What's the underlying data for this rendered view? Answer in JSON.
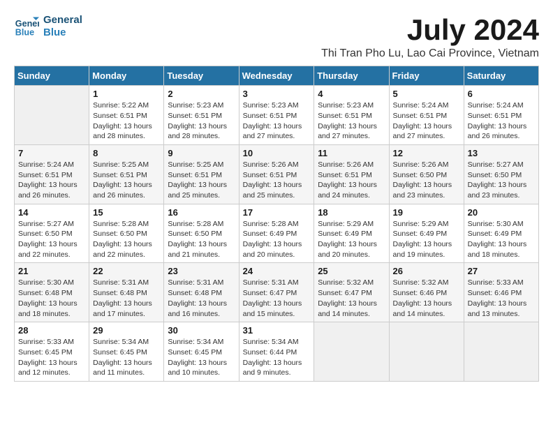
{
  "logo": {
    "line1": "General",
    "line2": "Blue"
  },
  "title": "July 2024",
  "subtitle": "Thi Tran Pho Lu, Lao Cai Province, Vietnam",
  "weekdays": [
    "Sunday",
    "Monday",
    "Tuesday",
    "Wednesday",
    "Thursday",
    "Friday",
    "Saturday"
  ],
  "weeks": [
    [
      {
        "day": "",
        "info": ""
      },
      {
        "day": "1",
        "info": "Sunrise: 5:22 AM\nSunset: 6:51 PM\nDaylight: 13 hours\nand 28 minutes."
      },
      {
        "day": "2",
        "info": "Sunrise: 5:23 AM\nSunset: 6:51 PM\nDaylight: 13 hours\nand 28 minutes."
      },
      {
        "day": "3",
        "info": "Sunrise: 5:23 AM\nSunset: 6:51 PM\nDaylight: 13 hours\nand 27 minutes."
      },
      {
        "day": "4",
        "info": "Sunrise: 5:23 AM\nSunset: 6:51 PM\nDaylight: 13 hours\nand 27 minutes."
      },
      {
        "day": "5",
        "info": "Sunrise: 5:24 AM\nSunset: 6:51 PM\nDaylight: 13 hours\nand 27 minutes."
      },
      {
        "day": "6",
        "info": "Sunrise: 5:24 AM\nSunset: 6:51 PM\nDaylight: 13 hours\nand 26 minutes."
      }
    ],
    [
      {
        "day": "7",
        "info": "Sunrise: 5:24 AM\nSunset: 6:51 PM\nDaylight: 13 hours\nand 26 minutes."
      },
      {
        "day": "8",
        "info": "Sunrise: 5:25 AM\nSunset: 6:51 PM\nDaylight: 13 hours\nand 26 minutes."
      },
      {
        "day": "9",
        "info": "Sunrise: 5:25 AM\nSunset: 6:51 PM\nDaylight: 13 hours\nand 25 minutes."
      },
      {
        "day": "10",
        "info": "Sunrise: 5:26 AM\nSunset: 6:51 PM\nDaylight: 13 hours\nand 25 minutes."
      },
      {
        "day": "11",
        "info": "Sunrise: 5:26 AM\nSunset: 6:51 PM\nDaylight: 13 hours\nand 24 minutes."
      },
      {
        "day": "12",
        "info": "Sunrise: 5:26 AM\nSunset: 6:50 PM\nDaylight: 13 hours\nand 23 minutes."
      },
      {
        "day": "13",
        "info": "Sunrise: 5:27 AM\nSunset: 6:50 PM\nDaylight: 13 hours\nand 23 minutes."
      }
    ],
    [
      {
        "day": "14",
        "info": "Sunrise: 5:27 AM\nSunset: 6:50 PM\nDaylight: 13 hours\nand 22 minutes."
      },
      {
        "day": "15",
        "info": "Sunrise: 5:28 AM\nSunset: 6:50 PM\nDaylight: 13 hours\nand 22 minutes."
      },
      {
        "day": "16",
        "info": "Sunrise: 5:28 AM\nSunset: 6:50 PM\nDaylight: 13 hours\nand 21 minutes."
      },
      {
        "day": "17",
        "info": "Sunrise: 5:28 AM\nSunset: 6:49 PM\nDaylight: 13 hours\nand 20 minutes."
      },
      {
        "day": "18",
        "info": "Sunrise: 5:29 AM\nSunset: 6:49 PM\nDaylight: 13 hours\nand 20 minutes."
      },
      {
        "day": "19",
        "info": "Sunrise: 5:29 AM\nSunset: 6:49 PM\nDaylight: 13 hours\nand 19 minutes."
      },
      {
        "day": "20",
        "info": "Sunrise: 5:30 AM\nSunset: 6:49 PM\nDaylight: 13 hours\nand 18 minutes."
      }
    ],
    [
      {
        "day": "21",
        "info": "Sunrise: 5:30 AM\nSunset: 6:48 PM\nDaylight: 13 hours\nand 18 minutes."
      },
      {
        "day": "22",
        "info": "Sunrise: 5:31 AM\nSunset: 6:48 PM\nDaylight: 13 hours\nand 17 minutes."
      },
      {
        "day": "23",
        "info": "Sunrise: 5:31 AM\nSunset: 6:48 PM\nDaylight: 13 hours\nand 16 minutes."
      },
      {
        "day": "24",
        "info": "Sunrise: 5:31 AM\nSunset: 6:47 PM\nDaylight: 13 hours\nand 15 minutes."
      },
      {
        "day": "25",
        "info": "Sunrise: 5:32 AM\nSunset: 6:47 PM\nDaylight: 13 hours\nand 14 minutes."
      },
      {
        "day": "26",
        "info": "Sunrise: 5:32 AM\nSunset: 6:46 PM\nDaylight: 13 hours\nand 14 minutes."
      },
      {
        "day": "27",
        "info": "Sunrise: 5:33 AM\nSunset: 6:46 PM\nDaylight: 13 hours\nand 13 minutes."
      }
    ],
    [
      {
        "day": "28",
        "info": "Sunrise: 5:33 AM\nSunset: 6:45 PM\nDaylight: 13 hours\nand 12 minutes."
      },
      {
        "day": "29",
        "info": "Sunrise: 5:34 AM\nSunset: 6:45 PM\nDaylight: 13 hours\nand 11 minutes."
      },
      {
        "day": "30",
        "info": "Sunrise: 5:34 AM\nSunset: 6:45 PM\nDaylight: 13 hours\nand 10 minutes."
      },
      {
        "day": "31",
        "info": "Sunrise: 5:34 AM\nSunset: 6:44 PM\nDaylight: 13 hours\nand 9 minutes."
      },
      {
        "day": "",
        "info": ""
      },
      {
        "day": "",
        "info": ""
      },
      {
        "day": "",
        "info": ""
      }
    ]
  ]
}
